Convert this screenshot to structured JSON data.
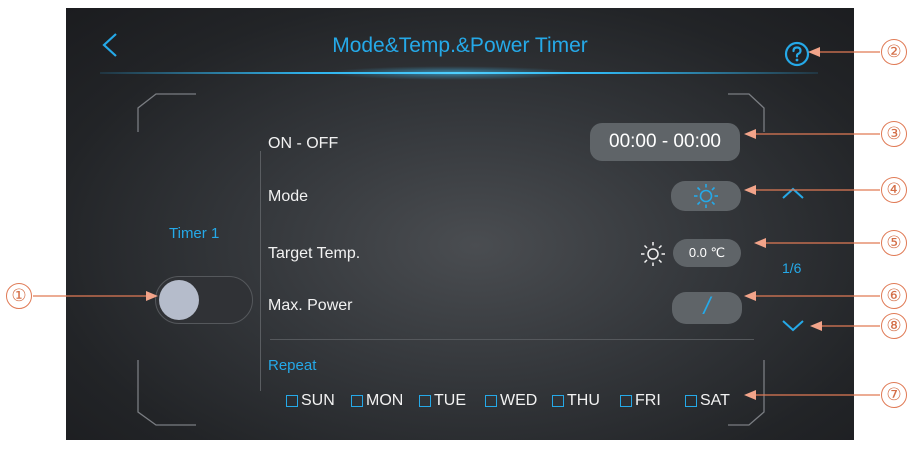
{
  "header": {
    "title": "Mode&Temp.&Power Timer"
  },
  "timer": {
    "label": "Timer 1",
    "enabled": false
  },
  "rows": {
    "on_off_label": "ON - OFF",
    "on_off_value": "00:00 - 00:00",
    "mode_label": "Mode",
    "target_temp_label": "Target Temp.",
    "target_temp_value": "0.0 ℃",
    "max_power_label": "Max. Power",
    "max_power_value": "/"
  },
  "repeat": {
    "label": "Repeat",
    "days": [
      "SUN",
      "MON",
      "TUE",
      "WED",
      "THU",
      "FRI",
      "SAT"
    ]
  },
  "pagination": {
    "indicator": "1/6"
  },
  "callouts": [
    "①",
    "②",
    "③",
    "④",
    "⑤",
    "⑥",
    "⑦",
    "⑧"
  ],
  "colors": {
    "accent": "#25a9e8",
    "callout": "#e07a55",
    "pill": "#5f6468"
  },
  "icons": {
    "back": "chevron-left-icon",
    "help": "question-circle-icon",
    "mode": "sun-icon",
    "temp_mode": "sun-icon",
    "page_up": "chevron-up-icon",
    "page_down": "chevron-down-icon"
  }
}
